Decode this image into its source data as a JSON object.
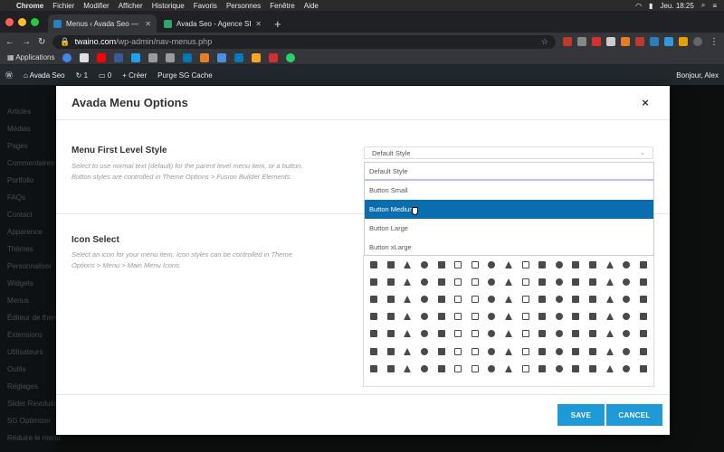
{
  "mac_menubar": {
    "app": "Chrome",
    "menus": [
      "Fichier",
      "Modifier",
      "Afficher",
      "Historique",
      "Favoris",
      "Personnes",
      "Fenêtre",
      "Aide"
    ],
    "clock": "Jeu. 18:25"
  },
  "browser": {
    "tabs": [
      {
        "title": "Menus ‹ Avada Seo — WordPre"
      },
      {
        "title": "Avada Seo - Agence SEO"
      }
    ],
    "url_host": "twaino.com",
    "url_path": "/wp-admin/nav-menus.php",
    "bookmarks_label": "Applications"
  },
  "wp_admin_bar": {
    "site": "Avada Seo",
    "updates": "1",
    "comments": "0",
    "new": "Créer",
    "purge": "Purge SG Cache",
    "greeting": "Bonjour, Alex"
  },
  "wp_sidebar": [
    "Articles",
    "Médias",
    "Pages",
    "Commentaires",
    "Portfolio",
    "FAQs",
    "Contact",
    "Apparence",
    "Thèmes",
    "Personnaliser",
    "Widgets",
    "Menus",
    "Éditeur de thème",
    "Extensions",
    "Utilisateurs",
    "Outils",
    "Réglages",
    "Slider Revolution",
    "SG Optimizer",
    "Réduire le menu"
  ],
  "modal": {
    "title": "Avada Menu Options",
    "close": "×",
    "first_level": {
      "title": "Menu First Level Style",
      "desc": "Select to use normal text (default) for the parent level menu item, or a button. Button styles are controlled in Theme Options > Fusion Builder Elements.",
      "selected": "Default Style",
      "options": [
        "Default Style",
        "Button Small",
        "Button Medium",
        "Button Large",
        "Button xLarge"
      ],
      "highlighted": "Button Medium"
    },
    "icon_select": {
      "title": "Icon Select",
      "desc": "Select an icon for your menu item. Icon styles can be controlled in Theme Options > Menu > Main Menu Icons."
    },
    "save": "SAVE",
    "cancel": "CANCEL"
  },
  "colors": {
    "accent": "#1e9ad6",
    "highlight": "#0a6dad"
  }
}
